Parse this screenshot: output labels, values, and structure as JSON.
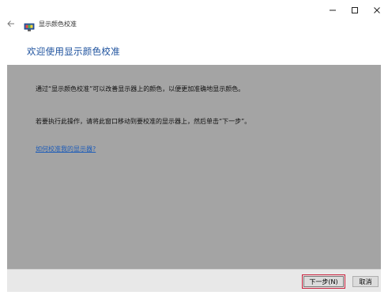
{
  "window": {
    "title": "显示颜色校准",
    "controls": {
      "minimize": "—",
      "maximize": "☐",
      "close": "✕"
    }
  },
  "nav": {
    "back_icon": "left-arrow-icon"
  },
  "heading": "欢迎使用显示颜色校准",
  "content": {
    "paragraph1": "通过“显示颜色校准”可以改善显示器上的颜色，以便更加准确地显示颜色。",
    "paragraph2": "若要执行此操作，请将此窗口移动到要校准的显示器上，然后单击“下一步”。",
    "help_link": "如何校准我的显示器?"
  },
  "footer": {
    "next_button": "下一步(N)",
    "cancel_button": "取消"
  },
  "colors": {
    "heading": "#1a4f9c",
    "content_bg": "#a4a4a4",
    "link": "#1f5db8",
    "next_highlight": "#c81e3a"
  }
}
